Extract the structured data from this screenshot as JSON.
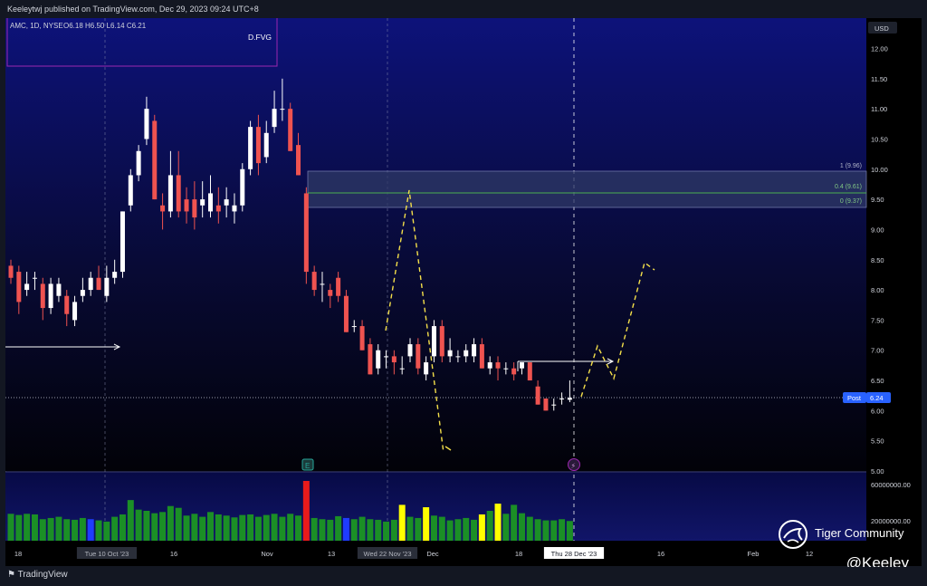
{
  "header": {
    "publish_line": "Keeleytwj published on TradingView.com, Dec 29, 2023 09:24 UTC+8"
  },
  "legend": {
    "symbol": "AMC, 1D, NYSE",
    "ohlc": "O6.18  H6.50  L6.14  C6.21"
  },
  "fvg_label": "D.FVG",
  "currency": "USD",
  "post_badge": {
    "label": "Post",
    "value": "6.24"
  },
  "fib_labels": [
    "1 (9.96)",
    "0.4 (9.61)",
    "0 (9.37)"
  ],
  "earnings_marker": "E",
  "flash_marker": "⚡",
  "brand": {
    "tradingview": "TradingView",
    "tiger": "Tiger Community",
    "handle": "@Keeley"
  },
  "colors": {
    "up": "#ffffff",
    "down": "#ef5350",
    "vol_normal": "#1b8f26",
    "vol_red": "#e81b1b",
    "vol_yellow": "#ffff00",
    "vol_blue": "#1f3cff",
    "fvg_box": "#2f3966",
    "forecast": "#f5e04a"
  },
  "chart_data": {
    "type": "candlestick",
    "title": "AMC, 1D, NYSE",
    "ylabel": "USD",
    "ylim": [
      5.0,
      12.4
    ],
    "price_ticks": [
      "12.00",
      "11.50",
      "11.00",
      "10.50",
      "10.00",
      "9.50",
      "9.00",
      "8.50",
      "8.00",
      "7.50",
      "7.00",
      "6.50",
      "6.00",
      "5.50",
      "5.00"
    ],
    "x_ticks": [
      "18",
      "Tue 10 Oct '23",
      "16",
      "Nov",
      "13",
      "Wed 22 Nov '23",
      "Dec",
      "18",
      "Thu 28 Dec '23",
      "16",
      "Feb",
      "12"
    ],
    "volume_ticks": [
      "60000000.00",
      "20000000.00"
    ],
    "candles": [
      [
        8.4,
        8.5,
        8.1,
        8.2
      ],
      [
        8.3,
        8.4,
        7.6,
        7.8
      ],
      [
        8.0,
        8.3,
        7.9,
        8.1
      ],
      [
        8.2,
        8.3,
        8.0,
        8.2
      ],
      [
        8.1,
        8.2,
        7.5,
        7.7
      ],
      [
        7.7,
        8.2,
        7.6,
        8.1
      ],
      [
        7.9,
        8.2,
        7.8,
        8.1
      ],
      [
        7.9,
        8.0,
        7.4,
        7.6
      ],
      [
        7.5,
        7.9,
        7.4,
        7.8
      ],
      [
        7.9,
        8.2,
        7.8,
        8.0
      ],
      [
        8.0,
        8.3,
        7.9,
        8.2
      ],
      [
        8.2,
        8.4,
        8.0,
        8.0
      ],
      [
        7.9,
        8.4,
        7.8,
        8.2
      ],
      [
        8.2,
        8.5,
        8.1,
        8.3
      ],
      [
        8.3,
        9.3,
        8.2,
        9.3
      ],
      [
        9.4,
        10.0,
        9.3,
        9.9
      ],
      [
        9.9,
        10.4,
        9.8,
        10.3
      ],
      [
        10.5,
        11.2,
        10.4,
        11.0
      ],
      [
        10.8,
        10.9,
        9.5,
        9.5
      ],
      [
        9.4,
        9.6,
        9.0,
        9.3
      ],
      [
        9.3,
        10.3,
        9.2,
        9.9
      ],
      [
        9.9,
        10.3,
        9.2,
        9.3
      ],
      [
        9.5,
        9.7,
        9.1,
        9.3
      ],
      [
        9.5,
        9.8,
        9.0,
        9.2
      ],
      [
        9.4,
        9.8,
        9.2,
        9.5
      ],
      [
        9.3,
        9.9,
        9.2,
        9.6
      ],
      [
        9.4,
        9.7,
        9.1,
        9.3
      ],
      [
        9.4,
        9.7,
        9.2,
        9.5
      ],
      [
        9.3,
        9.6,
        9.1,
        9.4
      ],
      [
        9.4,
        10.1,
        9.3,
        10.0
      ],
      [
        10.0,
        10.8,
        9.9,
        10.7
      ],
      [
        10.7,
        10.9,
        9.9,
        10.1
      ],
      [
        10.2,
        10.8,
        10.1,
        10.6
      ],
      [
        10.7,
        11.3,
        10.6,
        11.0
      ],
      [
        11.0,
        11.5,
        10.8,
        11.0
      ],
      [
        11.0,
        11.1,
        10.3,
        10.3
      ],
      [
        10.4,
        10.6,
        9.9,
        9.9
      ],
      [
        9.6,
        9.7,
        8.1,
        8.3
      ],
      [
        8.3,
        8.4,
        7.9,
        8.0
      ],
      [
        8.1,
        8.3,
        7.8,
        8.1
      ],
      [
        8.0,
        8.1,
        7.7,
        7.9
      ],
      [
        8.2,
        8.3,
        7.8,
        7.9
      ],
      [
        7.9,
        8.0,
        7.3,
        7.3
      ],
      [
        7.4,
        7.5,
        7.3,
        7.4
      ],
      [
        7.4,
        7.5,
        7.0,
        7.0
      ],
      [
        7.1,
        7.2,
        6.6,
        6.6
      ],
      [
        6.7,
        7.1,
        6.6,
        7.0
      ],
      [
        6.9,
        7.0,
        6.7,
        6.9
      ],
      [
        6.9,
        7.0,
        6.6,
        6.8
      ],
      [
        6.7,
        6.9,
        6.6,
        6.7
      ],
      [
        6.9,
        7.2,
        6.8,
        7.1
      ],
      [
        7.1,
        7.2,
        6.6,
        6.7
      ],
      [
        6.6,
        6.9,
        6.5,
        6.8
      ],
      [
        6.9,
        7.5,
        6.8,
        7.4
      ],
      [
        7.4,
        7.5,
        6.8,
        6.9
      ],
      [
        6.9,
        7.2,
        6.8,
        7.0
      ],
      [
        6.9,
        7.0,
        6.8,
        6.9
      ],
      [
        6.9,
        7.1,
        6.8,
        7.0
      ],
      [
        6.9,
        7.2,
        6.8,
        7.1
      ],
      [
        7.1,
        7.2,
        6.7,
        6.7
      ],
      [
        6.7,
        6.9,
        6.6,
        6.8
      ],
      [
        6.8,
        6.9,
        6.5,
        6.7
      ],
      [
        6.7,
        6.8,
        6.6,
        6.7
      ],
      [
        6.7,
        6.8,
        6.5,
        6.6
      ],
      [
        6.7,
        6.8,
        6.6,
        6.8
      ],
      [
        6.8,
        6.8,
        6.5,
        6.5
      ],
      [
        6.4,
        6.5,
        6.1,
        6.1
      ],
      [
        6.2,
        6.2,
        6.0,
        6.0
      ],
      [
        6.1,
        6.2,
        6.0,
        6.1
      ],
      [
        6.2,
        6.3,
        6.1,
        6.2
      ],
      [
        6.18,
        6.5,
        6.14,
        6.21
      ]
    ],
    "volume_levels": [
      0.45,
      0.43,
      0.45,
      0.44,
      0.36,
      0.38,
      0.4,
      0.36,
      0.35,
      0.38,
      0.36,
      0.34,
      0.32,
      0.4,
      0.44,
      0.68,
      0.52,
      0.5,
      0.46,
      0.48,
      0.58,
      0.55,
      0.42,
      0.45,
      0.4,
      0.48,
      0.44,
      0.42,
      0.39,
      0.43,
      0.44,
      0.4,
      0.43,
      0.45,
      0.4,
      0.45,
      0.42,
      1.0,
      0.38,
      0.36,
      0.35,
      0.41,
      0.38,
      0.36,
      0.4,
      0.36,
      0.35,
      0.32,
      0.35,
      0.6,
      0.4,
      0.38,
      0.56,
      0.42,
      0.4,
      0.34,
      0.36,
      0.38,
      0.35,
      0.44,
      0.5,
      0.62,
      0.45,
      0.6,
      0.46,
      0.4,
      0.36,
      0.34,
      0.34,
      0.36,
      0.33
    ],
    "volume_colors": {
      "red": [
        37
      ],
      "yellow": [
        49,
        52,
        59,
        61
      ],
      "blue": [
        10,
        42
      ]
    }
  }
}
